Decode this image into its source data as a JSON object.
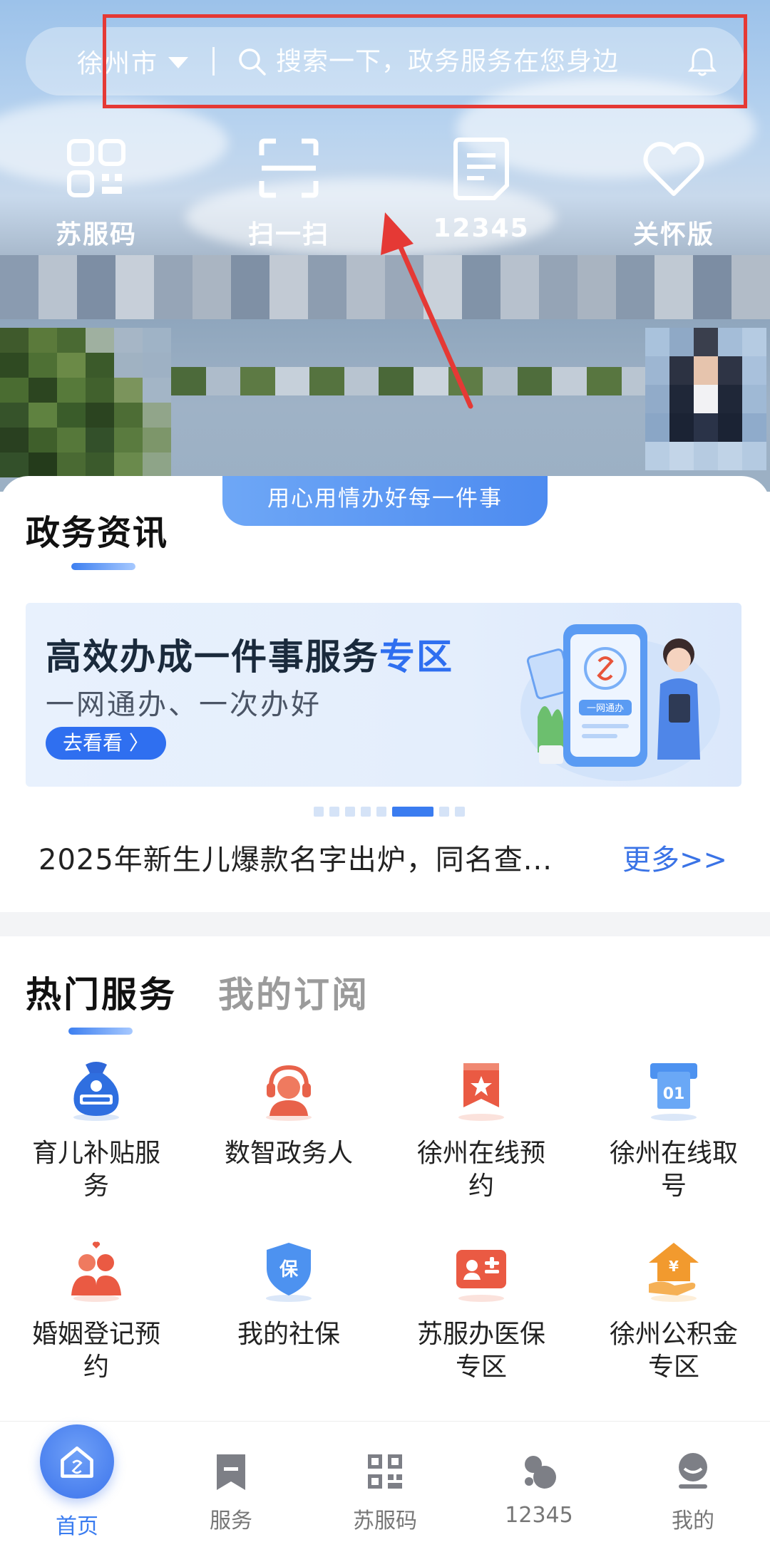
{
  "header": {
    "city": "徐州市",
    "search_placeholder": "搜索一下，政务服务在您身边"
  },
  "quick_actions": [
    {
      "label": "苏服码",
      "icon": "qr-code-icon"
    },
    {
      "label": "扫一扫",
      "icon": "scan-icon"
    },
    {
      "label": "12345",
      "icon": "document-icon"
    },
    {
      "label": "关怀版",
      "icon": "heart-icon"
    }
  ],
  "news": {
    "title": "政务资讯",
    "slogan": "用心用情办好每一件事",
    "banner": {
      "title_main": "高效办成一件事服务",
      "title_accent": "专区",
      "subtitle": "一网通办、一次办好",
      "button": "去看看 〉",
      "art_label": "一网通办"
    },
    "headline": "2025年新生儿爆款名字出炉，同名查...",
    "more": "更多>>"
  },
  "services": {
    "tab_active": "热门服务",
    "tab_inactive": "我的订阅",
    "items": [
      {
        "label": "育儿补贴服务",
        "icon": "childcare-subsidy-icon"
      },
      {
        "label": "数智政务人",
        "icon": "digital-agent-icon"
      },
      {
        "label": "徐州在线预约",
        "icon": "appointment-icon"
      },
      {
        "label": "徐州在线取号",
        "icon": "queue-number-icon"
      },
      {
        "label": "婚姻登记预约",
        "icon": "marriage-icon"
      },
      {
        "label": "我的社保",
        "icon": "social-security-icon"
      },
      {
        "label": "苏服办医保专区",
        "icon": "medical-insurance-icon"
      },
      {
        "label": "徐州公积金专区",
        "icon": "housing-fund-icon"
      }
    ]
  },
  "bottom_nav": [
    {
      "label": "首页",
      "icon": "home-icon"
    },
    {
      "label": "服务",
      "icon": "bookmark-icon"
    },
    {
      "label": "苏服码",
      "icon": "qr-code-icon"
    },
    {
      "label": "12345",
      "icon": "hotline-icon"
    },
    {
      "label": "我的",
      "icon": "profile-icon"
    }
  ],
  "colors": {
    "accent": "#3a7cf0",
    "highlight": "#e53935"
  }
}
